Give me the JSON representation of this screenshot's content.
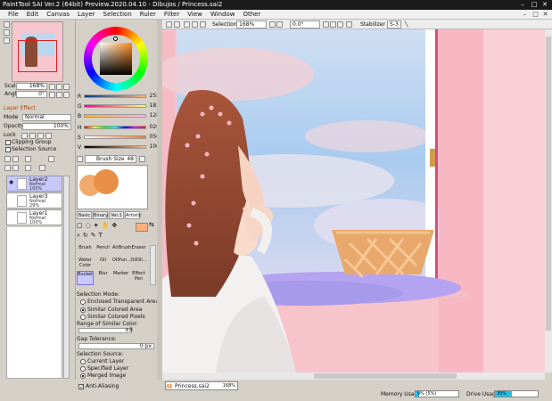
{
  "title": "PaintTool SAI Ver.2 (64bit) Preview.2020.04.10 - Dibujos / Princess.sai2",
  "window_controls": [
    "–",
    "□",
    "✕"
  ],
  "menu": [
    "File",
    "Edit",
    "Canvas",
    "Layer",
    "Selection",
    "Ruler",
    "Filter",
    "View",
    "Window",
    "Other"
  ],
  "navigator": {
    "scale_label": "Scale",
    "scale_value": "168%",
    "angle_label": "Angle",
    "angle_value": "0°"
  },
  "layer_effect": "Layer Effect",
  "mode_label": "Mode",
  "mode_value": "Normal",
  "opacity_label": "Opacity",
  "opacity_value": "100%",
  "lock_label": "Lock",
  "clipping_group": "Clipping Group",
  "selection_source": "Selection Source",
  "layers": [
    {
      "name": "Layer2",
      "mode": "Normal",
      "opacity": "100%",
      "selected": true
    },
    {
      "name": "Layer3",
      "mode": "Normal",
      "opacity": "29%",
      "selected": false
    },
    {
      "name": "Layer1",
      "mode": "Normal",
      "opacity": "100%",
      "selected": false
    }
  ],
  "colors": {
    "R": "255",
    "G": "183",
    "B": "128",
    "H": "026",
    "S": "050",
    "V": "100"
  },
  "brush_size_label": "Brush Size",
  "brush_size_value": "48",
  "brush_tabs": [
    "Basic",
    "Binary",
    "Ver.1",
    "Artistic"
  ],
  "tools": [
    "Brush",
    "Pencil",
    "AirBrush",
    "Eraser",
    "Water Color",
    "Oil",
    "OilPun...",
    "OilOil...",
    "Bucket",
    "Blur",
    "Marker",
    "Effect Pen"
  ],
  "selection_mode_label": "Selection Mode:",
  "selection_modes": [
    "Enclosed Transparent Area",
    "Similar Colored Area",
    "Similar Colored Pixels"
  ],
  "range_label": "Range of Similar Color:",
  "range_value": "±8",
  "gap_label": "Gap Tolerance:",
  "gap_value": "0 px",
  "selection_source_label": "Selection Source:",
  "selection_sources": [
    "Current Layer",
    "Specified Layer",
    "Merged Image"
  ],
  "anti_aliasing": "Anti-Aliasing",
  "toolbar": {
    "selection": "Selection",
    "zoom": "168%",
    "angle": "0.0°",
    "stabilizer": "Stabilizer",
    "stab_value": "S-3"
  },
  "document_tab": {
    "name": "Princess.sai2",
    "zoom": "168%"
  },
  "memory_label": "Memory Usage",
  "memory_value": "9% (5%)",
  "memory_fraction": 0.09,
  "drive_label": "Drive Usage",
  "drive_value": "39%",
  "drive_fraction": 0.39,
  "accent": "#f7a86b"
}
